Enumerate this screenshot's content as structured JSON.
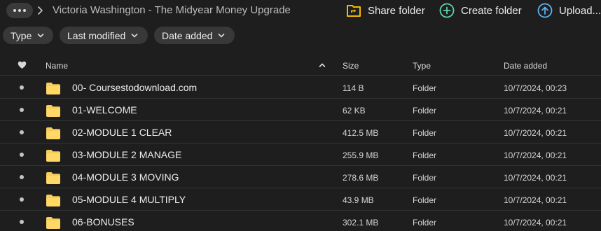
{
  "breadcrumb": {
    "more_icon": "more-horizontal-icon",
    "separator_icon": "chevron-right-icon",
    "title": "Victoria Washington - The Midyear Money Upgrade"
  },
  "actions": {
    "share": {
      "label": "Share folder",
      "icon": "share-folder-icon",
      "color": "#f5b800"
    },
    "create": {
      "label": "Create folder",
      "icon": "plus-circle-icon",
      "color": "#5fd3a8"
    },
    "upload": {
      "label": "Upload...",
      "icon": "upload-arrow-icon",
      "color": "#5ab4f0"
    }
  },
  "filters": [
    {
      "label": "Type"
    },
    {
      "label": "Last modified"
    },
    {
      "label": "Date added"
    }
  ],
  "table": {
    "columns": {
      "favorite_icon": "heart-icon",
      "name": "Name",
      "size": "Size",
      "type": "Type",
      "date_added": "Date added",
      "sort_icon": "chevron-up-icon"
    },
    "rows": [
      {
        "name": "00- Coursestodownload.com",
        "size": "114 B",
        "type": "Folder",
        "date_added": "10/7/2024, 00:23"
      },
      {
        "name": "01-WELCOME",
        "size": "62 KB",
        "type": "Folder",
        "date_added": "10/7/2024, 00:21"
      },
      {
        "name": "02-MODULE 1 CLEAR",
        "size": "412.5 MB",
        "type": "Folder",
        "date_added": "10/7/2024, 00:21"
      },
      {
        "name": "03-MODULE 2 MANAGE",
        "size": "255.9 MB",
        "type": "Folder",
        "date_added": "10/7/2024, 00:21"
      },
      {
        "name": "04-MODULE 3 MOVING",
        "size": "278.6 MB",
        "type": "Folder",
        "date_added": "10/7/2024, 00:21"
      },
      {
        "name": "05-MODULE 4 MULTIPLY",
        "size": "43.9 MB",
        "type": "Folder",
        "date_added": "10/7/2024, 00:21"
      },
      {
        "name": "06-BONUSES",
        "size": "302.1 MB",
        "type": "Folder",
        "date_added": "10/7/2024, 00:21"
      }
    ]
  },
  "colors": {
    "background": "#1e1e1e",
    "folder": "#f7cc5a",
    "chip": "#383838"
  }
}
